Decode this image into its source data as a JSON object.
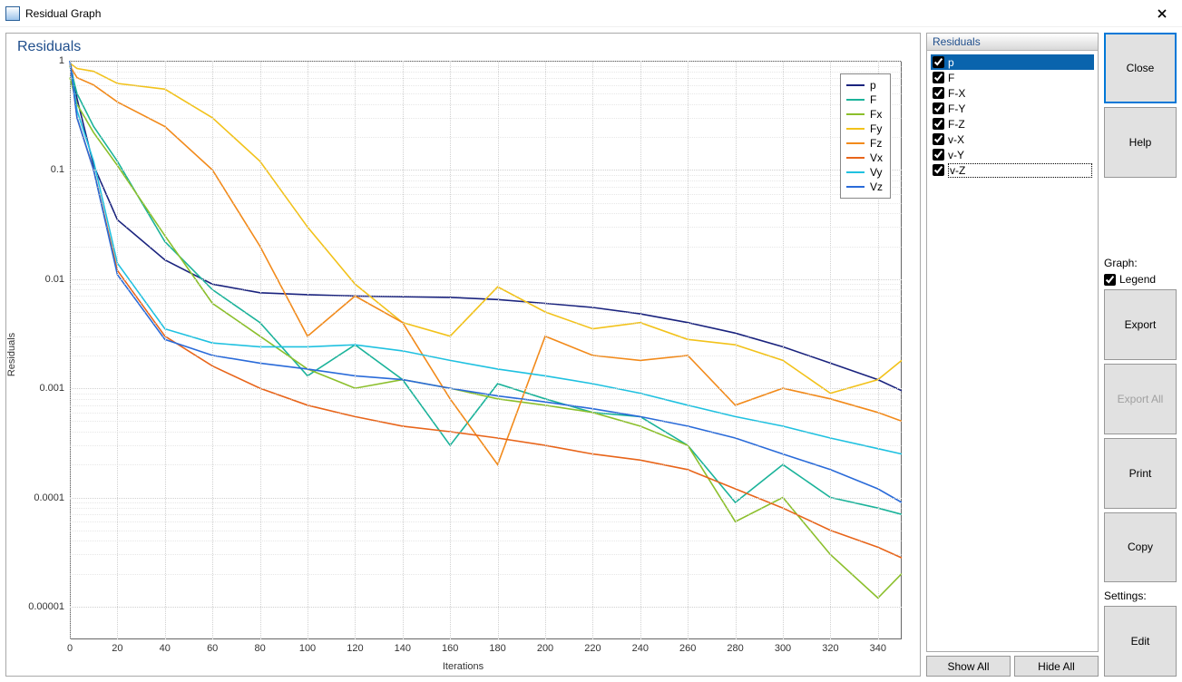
{
  "window": {
    "title": "Residual Graph"
  },
  "chart": {
    "title": "Residuals",
    "xlabel": "Iterations",
    "ylabel": "Residuals"
  },
  "legend": [
    {
      "label": "p",
      "color": "#1a237e"
    },
    {
      "label": "F",
      "color": "#1bb39a"
    },
    {
      "label": "Fx",
      "color": "#8bbf2b"
    },
    {
      "label": "Fy",
      "color": "#f2c21a"
    },
    {
      "label": "Fz",
      "color": "#f28a1a"
    },
    {
      "label": "Vx",
      "color": "#e8651a"
    },
    {
      "label": "Vy",
      "color": "#1fc1e0"
    },
    {
      "label": "Vz",
      "color": "#2a6bd9"
    }
  ],
  "residuals_panel": {
    "title": "Residuals",
    "items": [
      {
        "label": "p",
        "checked": true,
        "selected": true
      },
      {
        "label": "F",
        "checked": true
      },
      {
        "label": "F-X",
        "checked": true
      },
      {
        "label": "F-Y",
        "checked": true
      },
      {
        "label": "F-Z",
        "checked": true
      },
      {
        "label": "v-X",
        "checked": true
      },
      {
        "label": "v-Y",
        "checked": true
      },
      {
        "label": "v-Z",
        "checked": true,
        "editing": true
      }
    ],
    "show_all": "Show All",
    "hide_all": "Hide All"
  },
  "right": {
    "close": "Close",
    "help": "Help",
    "graph_label": "Graph:",
    "legend_chk": "Legend",
    "legend_checked": true,
    "export": "Export",
    "export_all": "Export All",
    "print": "Print",
    "copy": "Copy",
    "settings_label": "Settings:",
    "edit": "Edit"
  },
  "chart_data": {
    "type": "line",
    "title": "Residuals",
    "xlabel": "Iterations",
    "ylabel": "Residuals",
    "x_ticks": [
      0,
      20,
      40,
      60,
      80,
      100,
      120,
      140,
      160,
      180,
      200,
      220,
      240,
      260,
      280,
      300,
      320,
      340
    ],
    "y_ticks": [
      1,
      0.1,
      0.01,
      0.001,
      0.0001,
      1e-05
    ],
    "y_tick_labels": [
      "1",
      "0.1",
      "0.01",
      "0.001",
      "0.0001",
      "0.00001"
    ],
    "xlim": [
      0,
      350
    ],
    "ylim_log10": [
      -5.3,
      0
    ],
    "x": [
      0,
      3,
      10,
      20,
      40,
      60,
      80,
      100,
      120,
      140,
      160,
      180,
      200,
      220,
      240,
      260,
      280,
      300,
      320,
      340,
      350
    ],
    "series": [
      {
        "name": "p",
        "color": "#1a237e",
        "values": [
          1.0,
          0.45,
          0.11,
          0.035,
          0.015,
          0.009,
          0.0075,
          0.0072,
          0.007,
          0.0069,
          0.0068,
          0.0065,
          0.006,
          0.0055,
          0.0048,
          0.004,
          0.0032,
          0.0024,
          0.0017,
          0.0012,
          0.00095
        ]
      },
      {
        "name": "F",
        "color": "#1bb39a",
        "values": [
          0.9,
          0.5,
          0.25,
          0.12,
          0.022,
          0.008,
          0.004,
          0.0013,
          0.0025,
          0.0012,
          0.0003,
          0.0011,
          0.0008,
          0.0006,
          0.00055,
          0.0003,
          9e-05,
          0.0002,
          0.0001,
          8e-05,
          7e-05
        ]
      },
      {
        "name": "Fx",
        "color": "#8bbf2b",
        "values": [
          0.7,
          0.4,
          0.22,
          0.11,
          0.025,
          0.006,
          0.003,
          0.0015,
          0.001,
          0.0012,
          0.001,
          0.0008,
          0.0007,
          0.0006,
          0.00045,
          0.0003,
          6e-05,
          0.0001,
          3e-05,
          1.2e-05,
          2e-05
        ]
      },
      {
        "name": "Fy",
        "color": "#f2c21a",
        "values": [
          0.95,
          0.85,
          0.8,
          0.62,
          0.55,
          0.3,
          0.12,
          0.03,
          0.009,
          0.004,
          0.003,
          0.0085,
          0.005,
          0.0035,
          0.004,
          0.0028,
          0.0025,
          0.0018,
          0.0009,
          0.0012,
          0.0018
        ]
      },
      {
        "name": "Fz",
        "color": "#f28a1a",
        "values": [
          0.9,
          0.7,
          0.6,
          0.42,
          0.25,
          0.1,
          0.02,
          0.003,
          0.007,
          0.004,
          0.0008,
          0.0002,
          0.003,
          0.002,
          0.0018,
          0.002,
          0.0007,
          0.001,
          0.0008,
          0.0006,
          0.0005
        ]
      },
      {
        "name": "Vx",
        "color": "#e8651a",
        "values": [
          1.0,
          0.3,
          0.1,
          0.012,
          0.003,
          0.0016,
          0.001,
          0.0007,
          0.00055,
          0.00045,
          0.0004,
          0.00035,
          0.0003,
          0.00025,
          0.00022,
          0.00018,
          0.00012,
          8e-05,
          5e-05,
          3.5e-05,
          2.8e-05
        ]
      },
      {
        "name": "Vy",
        "color": "#1fc1e0",
        "values": [
          1.0,
          0.35,
          0.12,
          0.014,
          0.0035,
          0.0026,
          0.0024,
          0.0024,
          0.0025,
          0.0022,
          0.0018,
          0.0015,
          0.0013,
          0.0011,
          0.0009,
          0.0007,
          0.00055,
          0.00045,
          0.00035,
          0.00028,
          0.00025
        ]
      },
      {
        "name": "Vz",
        "color": "#2a6bd9",
        "values": [
          1.0,
          0.3,
          0.1,
          0.011,
          0.0028,
          0.002,
          0.0017,
          0.0015,
          0.0013,
          0.0012,
          0.001,
          0.00085,
          0.00075,
          0.00065,
          0.00055,
          0.00045,
          0.00035,
          0.00025,
          0.00018,
          0.00012,
          9e-05
        ]
      }
    ]
  }
}
